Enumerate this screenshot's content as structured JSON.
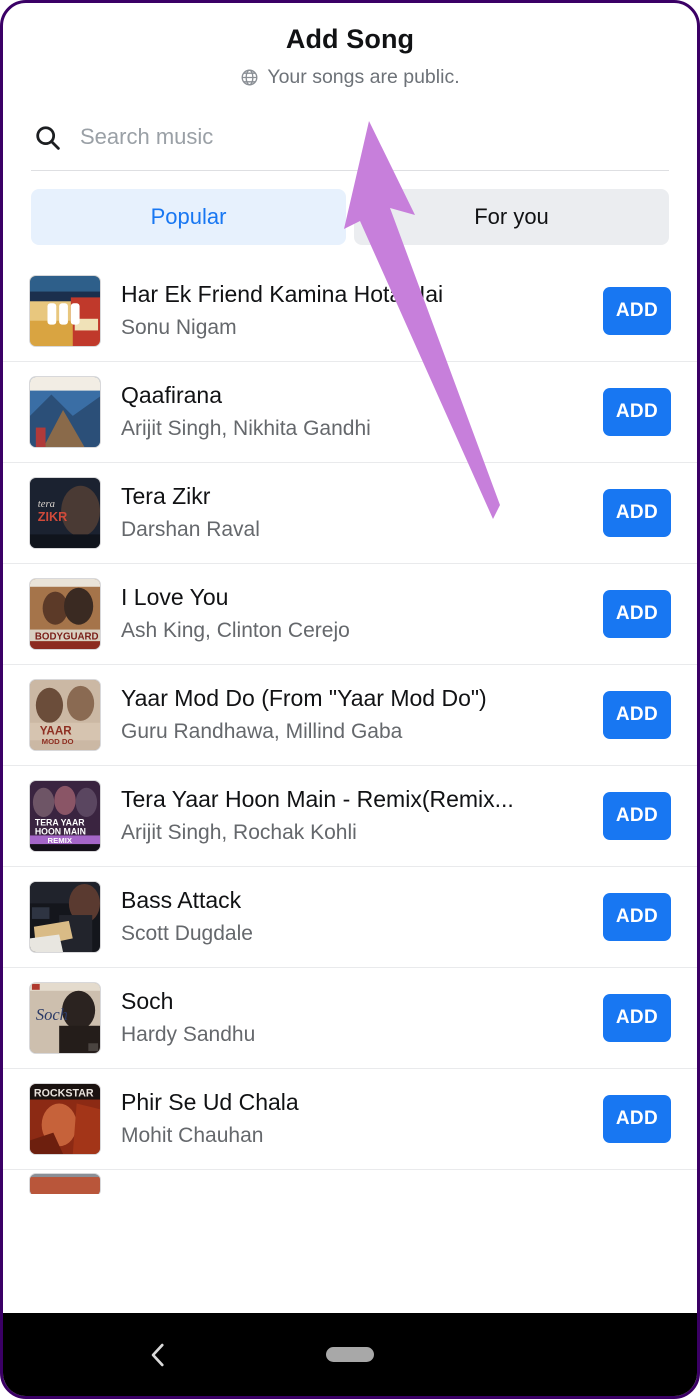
{
  "screen": {
    "title": "Add Song",
    "subtitle": "Your songs are public.",
    "globe_icon": "globe-icon",
    "border_color": "#3b0066"
  },
  "search": {
    "icon": "search-icon",
    "placeholder": "Search music",
    "value": ""
  },
  "tabs": {
    "items": [
      {
        "label": "Popular",
        "active": true
      },
      {
        "label": "For you",
        "active": false
      }
    ],
    "active_bg": "#e7f1fd",
    "active_text": "#1877f2",
    "inactive_bg": "#ebedf0",
    "inactive_text": "#111214"
  },
  "songs": {
    "add_label": "ADD",
    "add_color": "#1877f2",
    "items": [
      {
        "title": "Har Ek Friend Kamina Hota Hai",
        "artist": "Sonu Nigam"
      },
      {
        "title": "Qaafirana",
        "artist": "Arijit Singh, Nikhita Gandhi"
      },
      {
        "title": "Tera Zikr",
        "artist": "Darshan Raval"
      },
      {
        "title": "I Love You",
        "artist": "Ash King, Clinton Cerejo"
      },
      {
        "title": "Yaar Mod Do (From \"Yaar Mod Do\")",
        "artist": "Guru Randhawa, Millind Gaba"
      },
      {
        "title": "Tera Yaar Hoon Main - Remix(Remix...",
        "artist": "Arijit Singh, Rochak Kohli"
      },
      {
        "title": "Bass Attack",
        "artist": "Scott Dugdale"
      },
      {
        "title": "Soch",
        "artist": "Hardy Sandhu"
      },
      {
        "title": "Phir Se Ud Chala",
        "artist": "Mohit Chauhan"
      }
    ]
  },
  "navbar": {
    "back_icon": "back-chevron-icon",
    "home_indicator": "home-pill-indicator",
    "background": "#000000"
  },
  "annotation": {
    "arrow_color": "#c77fdb",
    "points_to": "Popular"
  }
}
